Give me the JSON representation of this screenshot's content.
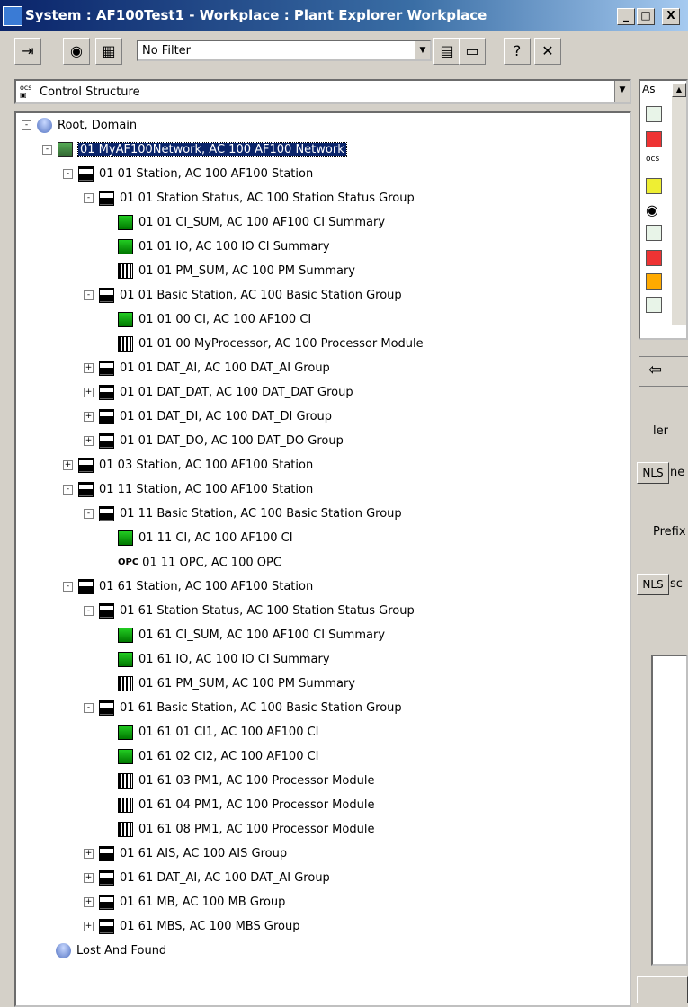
{
  "window": {
    "title": "System : AF100Test1 - Workplace : Plant Explorer Workplace",
    "minimize": "_",
    "maximize": "□",
    "close": "X"
  },
  "toolbar": {
    "filter_value": "No Filter"
  },
  "structure_selector": {
    "value": "Control Structure"
  },
  "tree": [
    {
      "label": "Root, Domain",
      "icon": "db-icon",
      "toggle": "-"
    },
    {
      "label": "01 MyAF100Network, AC 100 AF100 Network",
      "icon": "network-icon",
      "toggle": "-",
      "selected": true
    },
    {
      "label": "01 01 Station, AC 100 AF100 Station",
      "icon": "station-icon",
      "toggle": "-"
    },
    {
      "label": "01 01  Station Status, AC 100 Station Status Group",
      "icon": "station-icon",
      "toggle": "-"
    },
    {
      "label": "01 01 CI_SUM, AC 100 AF100 CI Summary",
      "icon": "ci-icon",
      "toggle": ""
    },
    {
      "label": "01 01 IO, AC 100 IO CI Summary",
      "icon": "ci-icon",
      "toggle": ""
    },
    {
      "label": "01 01 PM_SUM, AC 100 PM Summary",
      "icon": "pm-icon",
      "toggle": ""
    },
    {
      "label": "01 01  Basic Station, AC 100 Basic Station Group",
      "icon": "station-icon",
      "toggle": "-"
    },
    {
      "label": "01 01 00 CI, AC 100 AF100 CI",
      "icon": "ci-icon",
      "toggle": ""
    },
    {
      "label": "01 01 00 MyProcessor, AC 100 Processor Module",
      "icon": "pm-icon",
      "toggle": ""
    },
    {
      "label": "01 01 DAT_AI, AC 100 DAT_AI Group",
      "icon": "station-icon",
      "toggle": "+"
    },
    {
      "label": "01 01 DAT_DAT, AC 100 DAT_DAT Group",
      "icon": "station-icon",
      "toggle": "+"
    },
    {
      "label": "01 01 DAT_DI, AC 100 DAT_DI Group",
      "icon": "station-icon",
      "toggle": "+"
    },
    {
      "label": "01 01 DAT_DO, AC 100 DAT_DO Group",
      "icon": "station-icon",
      "toggle": "+"
    },
    {
      "label": "01 03 Station, AC 100 AF100 Station",
      "icon": "station-icon",
      "toggle": "+"
    },
    {
      "label": "01 11 Station, AC 100 AF100 Station",
      "icon": "station-icon",
      "toggle": "-"
    },
    {
      "label": "01 11  Basic Station, AC 100 Basic Station Group",
      "icon": "station-icon",
      "toggle": "-"
    },
    {
      "label": "01 11 CI, AC 100 AF100 CI",
      "icon": "ci-icon",
      "toggle": ""
    },
    {
      "label": "01 11 OPC, AC 100 OPC",
      "icon": "opc-icon",
      "toggle": "",
      "icon_text": "OPC"
    },
    {
      "label": "01 61 Station, AC 100 AF100 Station",
      "icon": "station-icon",
      "toggle": "-"
    },
    {
      "label": "01 61  Station Status, AC 100 Station Status Group",
      "icon": "station-icon",
      "toggle": "-"
    },
    {
      "label": "01 61 CI_SUM, AC 100 AF100 CI Summary",
      "icon": "ci-icon",
      "toggle": ""
    },
    {
      "label": "01 61 IO, AC 100 IO CI Summary",
      "icon": "ci-icon",
      "toggle": ""
    },
    {
      "label": "01 61 PM_SUM, AC 100 PM Summary",
      "icon": "pm-icon",
      "toggle": ""
    },
    {
      "label": "01 61  Basic Station, AC 100 Basic Station Group",
      "icon": "station-icon",
      "toggle": "-"
    },
    {
      "label": "01 61 01 CI1, AC 100 AF100 CI",
      "icon": "ci-icon",
      "toggle": ""
    },
    {
      "label": "01 61 02 CI2, AC 100 AF100 CI",
      "icon": "ci-icon",
      "toggle": ""
    },
    {
      "label": "01 61 03 PM1, AC 100 Processor Module",
      "icon": "pm-icon",
      "toggle": ""
    },
    {
      "label": "01 61 04 PM1, AC 100 Processor Module",
      "icon": "pm-icon",
      "toggle": ""
    },
    {
      "label": "01 61 08 PM1, AC 100 Processor Module",
      "icon": "pm-icon",
      "toggle": ""
    },
    {
      "label": "01 61 AIS, AC 100 AIS Group",
      "icon": "station-icon",
      "toggle": "+"
    },
    {
      "label": "01 61 DAT_AI, AC 100 DAT_AI Group",
      "icon": "station-icon",
      "toggle": "+"
    },
    {
      "label": "01 61 MB, AC 100 MB Group",
      "icon": "station-icon",
      "toggle": "+"
    },
    {
      "label": "01 61 MBS, AC 100 MBS Group",
      "icon": "station-icon",
      "toggle": "+"
    },
    {
      "label": "Lost And Found",
      "icon": "db-icon",
      "toggle": ""
    }
  ],
  "right_panel": {
    "header": "As",
    "label_ler": "ler",
    "nls1": "NLS",
    "nls1_suffix": "ne",
    "prefix": "Prefix",
    "nls2": "NLS",
    "nls2_suffix": "sc"
  }
}
